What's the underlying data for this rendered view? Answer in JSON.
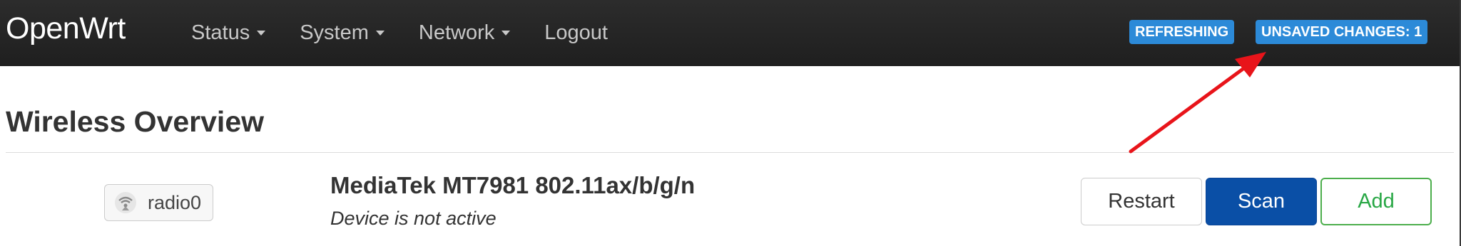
{
  "header": {
    "brand": "OpenWrt",
    "menu": [
      {
        "label": "Status",
        "has_dropdown": true
      },
      {
        "label": "System",
        "has_dropdown": true
      },
      {
        "label": "Network",
        "has_dropdown": true
      },
      {
        "label": "Logout",
        "has_dropdown": false
      }
    ],
    "badges": {
      "refreshing": "REFRESHING",
      "unsaved": "UNSAVED CHANGES: 1"
    }
  },
  "main": {
    "title": "Wireless Overview",
    "device": {
      "radio_label": "radio0",
      "name": "MediaTek MT7981 802.11ax/b/g/n",
      "status": "Device is not active",
      "buttons": {
        "restart": "Restart",
        "scan": "Scan",
        "add": "Add"
      }
    }
  },
  "colors": {
    "header_bg": "#222222",
    "badge_bg": "#2c8ad8",
    "scan_bg": "#0a4fa6",
    "add_border": "#4cae4c",
    "annotation_arrow": "#e8141a"
  },
  "icons": {
    "radio": "wifi-icon",
    "dropdown": "caret-down-icon"
  }
}
